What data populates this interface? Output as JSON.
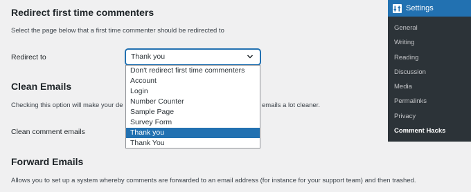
{
  "sections": {
    "redirect": {
      "title": "Redirect first time commenters",
      "description": "Select the page below that a first time commenter should be redirected to",
      "label": "Redirect to",
      "selected": "Thank you",
      "options": [
        "Don't redirect first time commenters",
        "Account",
        "Login",
        "Number Counter",
        "Sample Page",
        "Survey Form",
        "Thank you",
        "Thank You"
      ]
    },
    "clean": {
      "title": "Clean Emails",
      "description_left": "Checking this option will make your de",
      "description_right": "emails a lot cleaner.",
      "label": "Clean comment emails"
    },
    "forward": {
      "title": "Forward Emails",
      "description": "Allows you to set up a system whereby comments are forwarded to an email address (for instance for your support team) and then trashed."
    }
  },
  "sidebar": {
    "header": "Settings",
    "header_icon": "settings-icon",
    "items": [
      "General",
      "Writing",
      "Reading",
      "Discussion",
      "Media",
      "Permalinks",
      "Privacy",
      "Comment Hacks"
    ],
    "current": "Comment Hacks"
  },
  "colors": {
    "accent": "#2271b1",
    "sidebar_bg": "#2c3338",
    "page_bg": "#f0f0f1"
  }
}
